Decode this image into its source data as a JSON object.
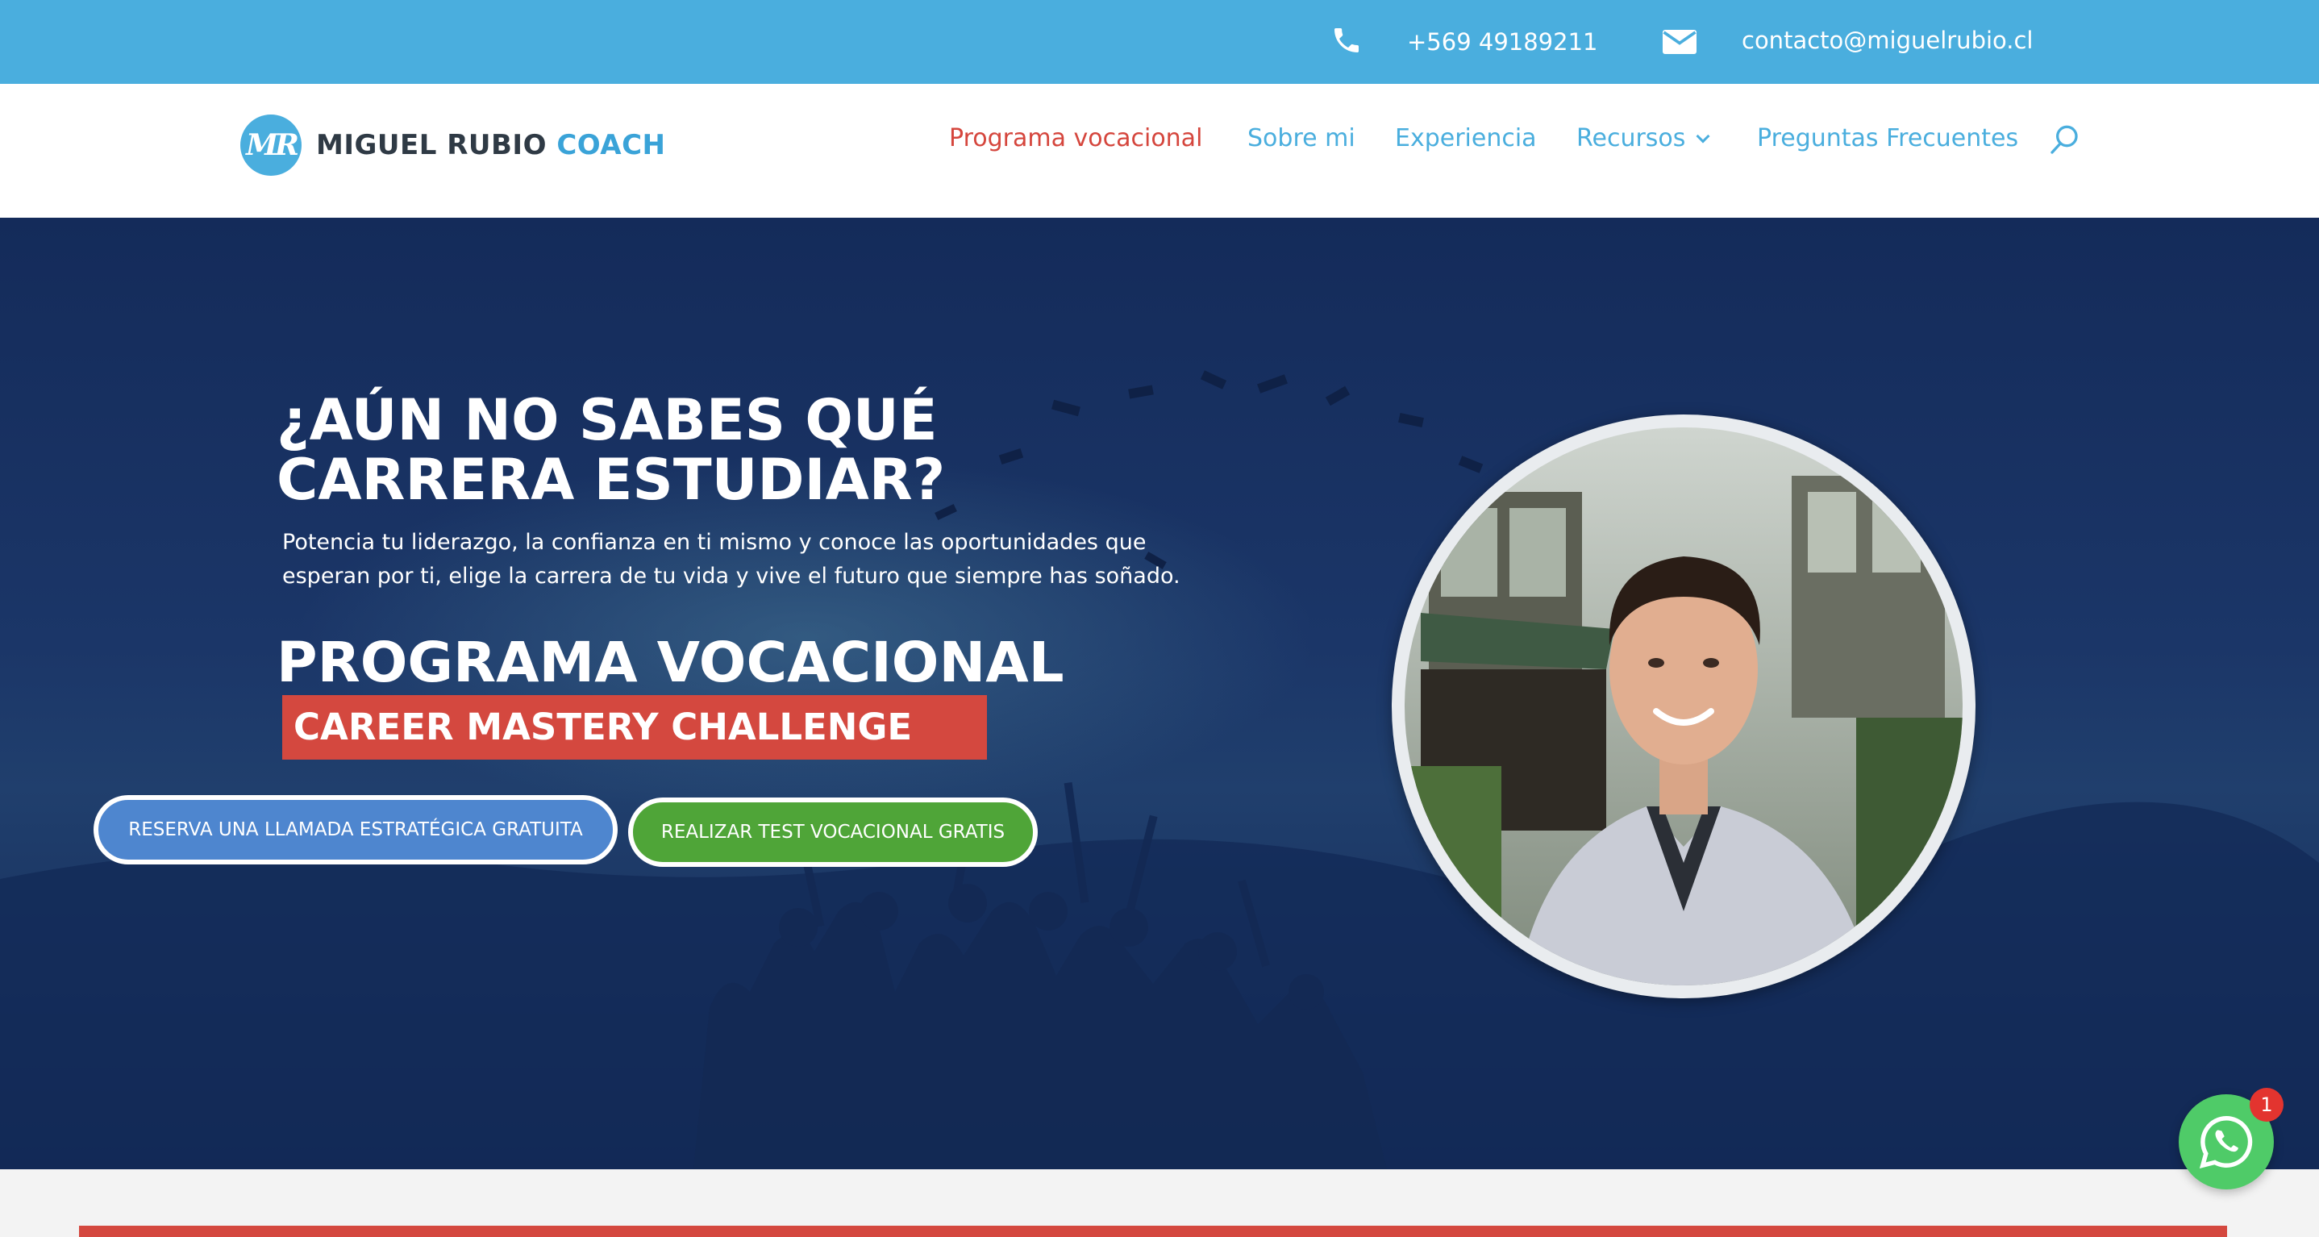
{
  "topbar": {
    "phone_icon": "phone-icon",
    "phone": "+569 49189211",
    "email_icon": "envelope-icon",
    "email": "contacto@miguelrubio.cl"
  },
  "header": {
    "logo_mark": "MR",
    "logo_name": "MIGUEL RUBIO",
    "logo_accent": "COACH",
    "nav": [
      {
        "label": "Programa vocacional",
        "active": true
      },
      {
        "label": "Sobre mi"
      },
      {
        "label": "Experiencia"
      },
      {
        "label": "Recursos",
        "has_dropdown": true
      },
      {
        "label": "Preguntas Frecuentes"
      }
    ],
    "search_icon": "search-icon"
  },
  "hero": {
    "title_line1": "¿AÚN NO SABES QUÉ",
    "title_line2": "CARRERA ESTUDIAR?",
    "subtitle_line1": "Potencia tu liderazgo, la confianza en ti mismo y conoce las oportunidades que",
    "subtitle_line2": "esperan por ti, elige la carrera de tu vida y vive el futuro que siempre has soñado.",
    "program": "PROGRAMA VOCACIONAL",
    "challenge": "CAREER MASTERY CHALLENGE",
    "btn_call": "RESERVA UNA LLAMADA ESTRATÉGICA GRATUITA",
    "btn_test": "REALIZAR TEST VOCACIONAL GRATIS"
  },
  "whatsapp": {
    "icon": "whatsapp-icon",
    "badge": "1"
  },
  "colors": {
    "topbar": "#4aaede",
    "nav_link": "#4aaede",
    "nav_active": "#d5463d",
    "hero_bg": "#1b3668",
    "challenge_bg": "#d4483f",
    "btn_call": "#4e86cf",
    "btn_test": "#4fa538",
    "whatsapp": "#4fcb68"
  }
}
